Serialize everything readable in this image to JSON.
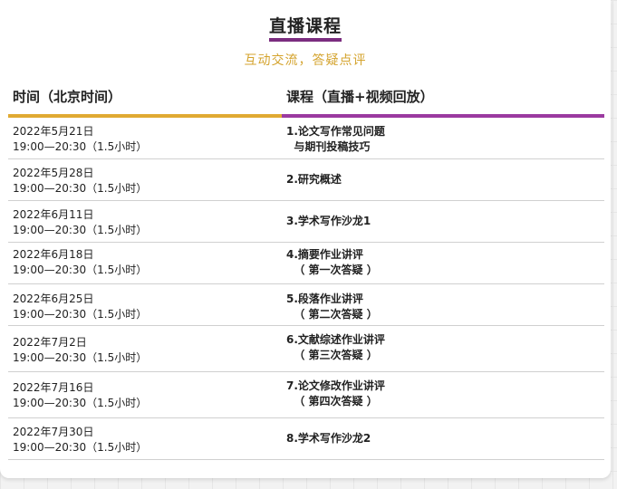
{
  "header": {
    "title": "直播课程",
    "subtitle": "互动交流，答疑点评"
  },
  "table": {
    "col_time": "时间（北京时间）",
    "col_course": "课程（直播+视频回放）",
    "colors": {
      "time_bar": "#e0aa33",
      "course_bar": "#9b3aa0",
      "title_underline": "#7b2d7f",
      "subtitle": "#d4a32d"
    },
    "rows": [
      {
        "date": "2022年5月21日",
        "time": "19:00—20:30（1.5小时）",
        "course1": "1.论文写作常见问题",
        "course2": "  与期刊投稿技巧"
      },
      {
        "date": "2022年5月28日",
        "time": "19:00—20:30（1.5小时）",
        "course1": "2.研究概述",
        "course2": ""
      },
      {
        "date": "2022年6月11日",
        "time": "19:00—20:30（1.5小时）",
        "course1": "3.学术写作沙龙1",
        "course2": ""
      },
      {
        "date": "2022年6月18日",
        "time": "19:00—20:30（1.5小时）",
        "course1": "4.摘要作业讲评",
        "course2": "  （ 第一次答疑 ）"
      },
      {
        "date": "2022年6月25日",
        "time": "19:00—20:30（1.5小时）",
        "course1": "5.段落作业讲评",
        "course2": "  （ 第二次答疑 ）"
      },
      {
        "date": "2022年7月2日",
        "time": "19:00—20:30（1.5小时）",
        "course1": "6.文献综述作业讲评",
        "course2": "  （ 第三次答疑 ）"
      },
      {
        "date": "2022年7月16日",
        "time": "19:00—20:30（1.5小时）",
        "course1": "7.论文修改作业讲评",
        "course2": "  （ 第四次答疑 ）"
      },
      {
        "date": "2022年7月30日",
        "time": "19:00—20:30（1.5小时）",
        "course1": "8.学术写作沙龙2",
        "course2": ""
      }
    ]
  }
}
